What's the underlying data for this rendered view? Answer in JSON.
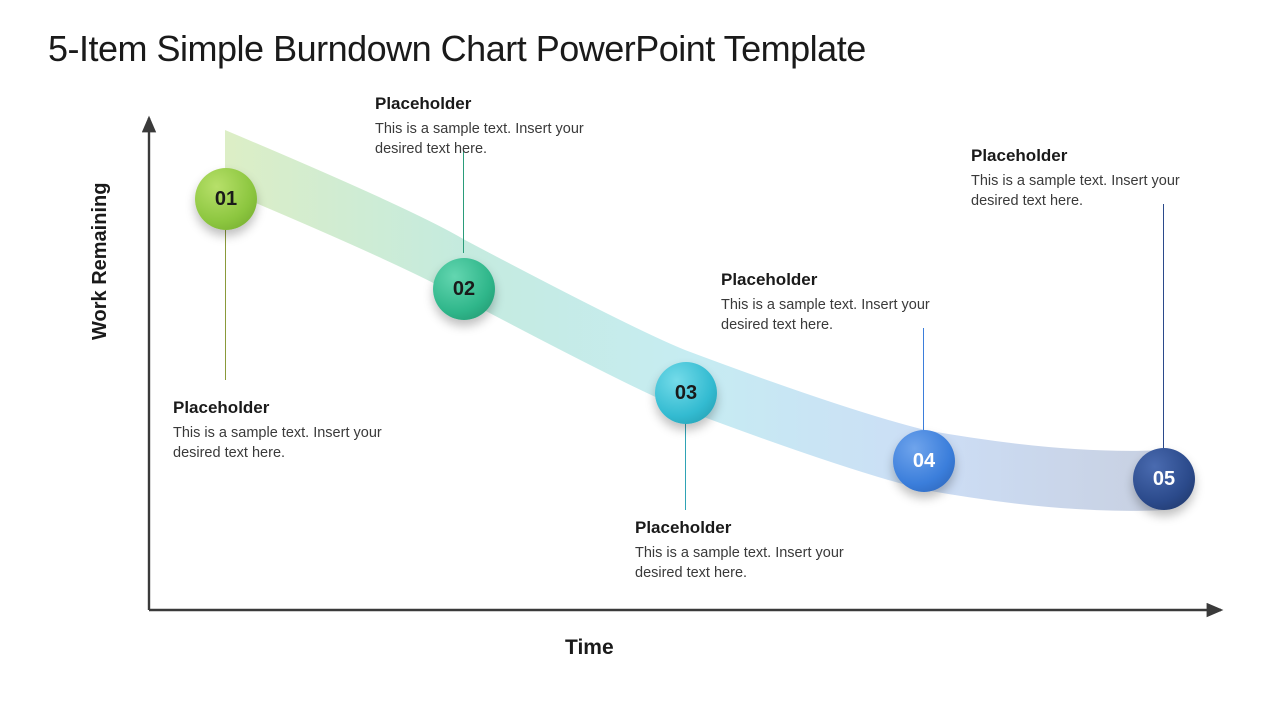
{
  "title": "5-Item Simple Burndown Chart PowerPoint Template",
  "axes": {
    "x": "Time",
    "y": "Work Remaining"
  },
  "items": [
    {
      "num": "01",
      "color": "#8CC63F",
      "text_color": "#1a1a1a",
      "label": "Placeholder",
      "body": "This is a sample text. Insert your desired text here."
    },
    {
      "num": "02",
      "color": "#2FB68A",
      "text_color": "#1a1a1a",
      "label": "Placeholder",
      "body": "This is a sample text. Insert your desired text here."
    },
    {
      "num": "03",
      "color": "#33BBD1",
      "text_color": "#1a1a1a",
      "label": "Placeholder",
      "body": "This is a sample text. Insert your desired text here."
    },
    {
      "num": "04",
      "color": "#3B7EDB",
      "text_color": "#ffffff",
      "label": "Placeholder",
      "body": "This is a sample text. Insert your desired text here."
    },
    {
      "num": "05",
      "color": "#2B4A8B",
      "text_color": "#ffffff",
      "label": "Placeholder",
      "body": "This is a sample text. Insert your desired text here."
    }
  ],
  "chart_data": {
    "type": "line",
    "title": "5-Item Simple Burndown Chart",
    "xlabel": "Time",
    "ylabel": "Work Remaining",
    "x": [
      1,
      2,
      3,
      4,
      5
    ],
    "values": [
      90,
      68,
      46,
      30,
      26
    ],
    "ylim": [
      0,
      100
    ],
    "series": [
      {
        "name": "Burndown",
        "values": [
          90,
          68,
          46,
          30,
          26
        ]
      }
    ],
    "colors": [
      "#8CC63F",
      "#2FB68A",
      "#33BBD1",
      "#3B7EDB",
      "#2B4A8B"
    ]
  }
}
